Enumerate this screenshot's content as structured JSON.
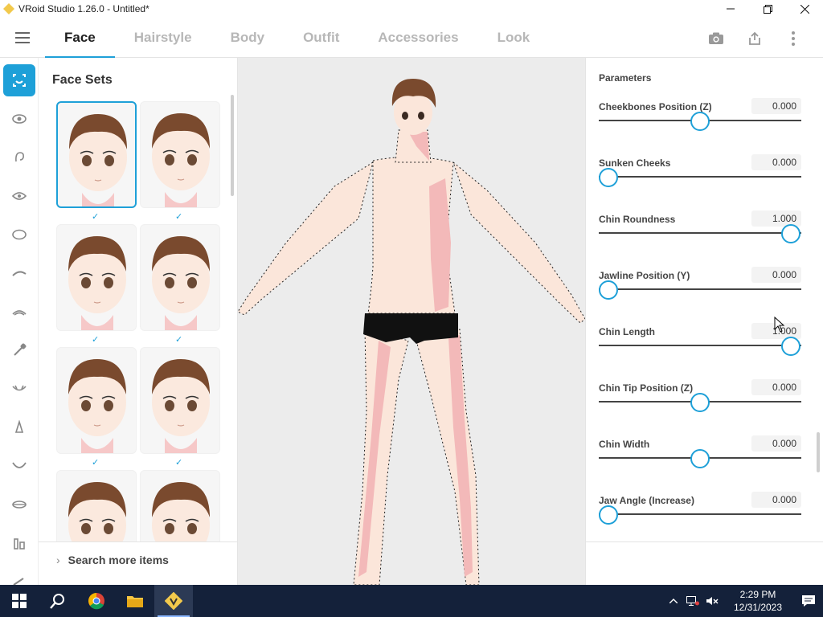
{
  "window": {
    "title": "VRoid Studio 1.26.0 - Untitled*",
    "controls": [
      "minimize-icon",
      "maximize-icon",
      "close-icon"
    ]
  },
  "nav": {
    "menu_icon": "hamburger-menu-icon",
    "tabs": [
      {
        "label": "Face",
        "active": true
      },
      {
        "label": "Hairstyle",
        "active": false
      },
      {
        "label": "Body",
        "active": false
      },
      {
        "label": "Outfit",
        "active": false
      },
      {
        "label": "Accessories",
        "active": false
      },
      {
        "label": "Look",
        "active": false
      }
    ],
    "actions": [
      "camera-icon",
      "export-icon",
      "more-options-icon"
    ]
  },
  "rail": {
    "items": [
      "face-set-icon",
      "eye-icon",
      "ear-icon",
      "eye-shape-icon",
      "face-outline-icon",
      "eyebrow-icon",
      "eyelash-icon",
      "eyedropper-icon",
      "mouth-icon",
      "nose-icon",
      "chin-icon",
      "lips-icon",
      "body-icon",
      "brush-icon"
    ]
  },
  "facesets": {
    "title": "Face Sets",
    "selected_index": 0,
    "count_visible": 8,
    "checked": [
      0,
      1,
      2,
      3,
      4,
      5
    ],
    "search_more": "Search more items"
  },
  "params": {
    "title": "Parameters",
    "items": [
      {
        "label": "Cheekbones Position (Z)",
        "value": "0.000",
        "level": 0.5
      },
      {
        "label": "Sunken Cheeks",
        "value": "0.000",
        "level": 0.0
      },
      {
        "label": "Chin Roundness",
        "value": "1.000",
        "level": 1.0
      },
      {
        "label": "Jawline Position (Y)",
        "value": "0.000",
        "level": 0.0
      },
      {
        "label": "Chin Length",
        "value": "1.000",
        "level": 1.0
      },
      {
        "label": "Chin Tip Position (Z)",
        "value": "0.000",
        "level": 0.5
      },
      {
        "label": "Chin Width",
        "value": "0.000",
        "level": 0.5
      },
      {
        "label": "Jaw Angle (Increase)",
        "value": "0.000",
        "level": 0.0
      }
    ]
  },
  "taskbar": {
    "pinned": [
      "windows-start-icon",
      "search-icon",
      "chrome-icon",
      "file-explorer-icon",
      "vroid-studio-icon"
    ],
    "active_index": 4,
    "tray": [
      "chevron-up-icon",
      "network-icon",
      "volume-muted-icon"
    ],
    "time": "2:29 PM",
    "date": "12/31/2023",
    "notification_icon": "notification-icon"
  },
  "colors": {
    "accent": "#1ea0d8",
    "taskbar": "#14213a",
    "viewport_bg": "#ececec",
    "skin": "#fbe6da",
    "skin_shadow": "#f3b9b9"
  }
}
